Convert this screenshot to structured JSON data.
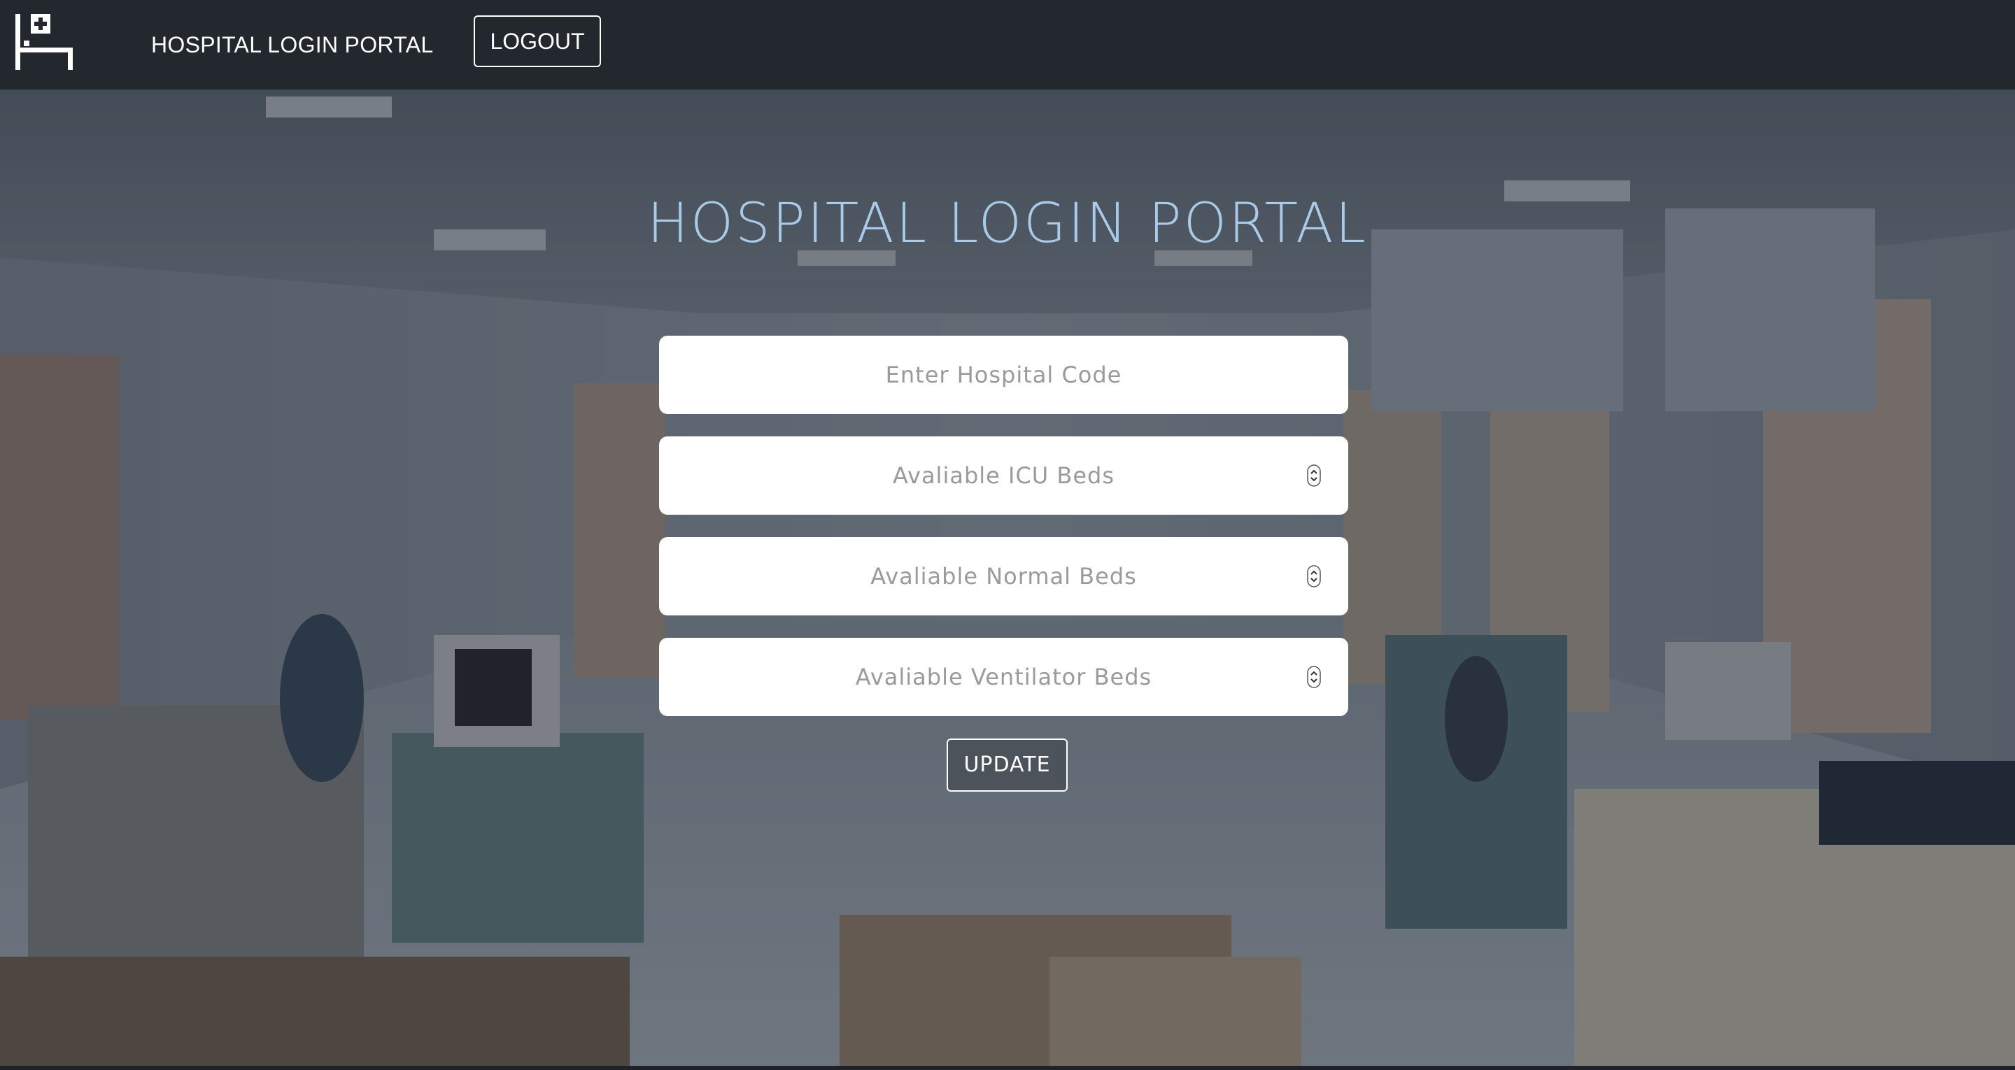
{
  "navbar": {
    "logo_icon": "hospital-bed-icon",
    "brand": "HOSPITAL LOGIN PORTAL",
    "logout_label": "LOGOUT"
  },
  "main": {
    "title": "HOSPITAL LOGIN PORTAL",
    "fields": {
      "hospital_code": {
        "placeholder": "Enter Hospital Code",
        "value": ""
      },
      "icu_beds": {
        "placeholder": "Avaliable ICU Beds",
        "value": ""
      },
      "normal_beds": {
        "placeholder": "Avaliable Normal Beds",
        "value": ""
      },
      "ventilator_beds": {
        "placeholder": "Avaliable Ventilator Beds",
        "value": ""
      }
    },
    "update_label": "UPDATE"
  },
  "colors": {
    "navbar_bg": "#23272e",
    "title": "#a9cbe8",
    "button_border": "#ffffff"
  }
}
